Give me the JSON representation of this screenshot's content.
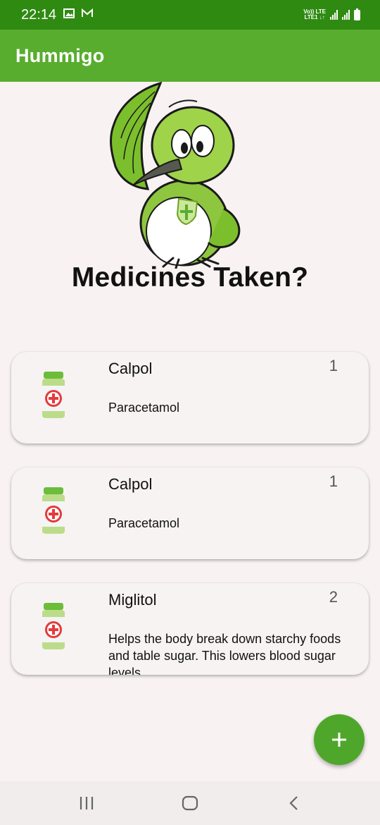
{
  "status_bar": {
    "time": "22:14",
    "notification_icons": [
      "image-icon",
      "gmail-icon"
    ],
    "network_label_top": "Vo)) LTE",
    "network_label_bottom": "LTE1 ↓↑",
    "signal_icons": [
      "signal-icon",
      "signal-icon"
    ],
    "battery_icon": "battery-icon"
  },
  "app_bar": {
    "title": "Hummigo"
  },
  "main": {
    "headline": "Medicines Taken?",
    "mascot_icon": "hummingbird-mascot-icon"
  },
  "medicines": [
    {
      "name": "Calpol",
      "count": "1",
      "description": "Paracetamol"
    },
    {
      "name": "Calpol",
      "count": "1",
      "description": "Paracetamol"
    },
    {
      "name": "Miglitol",
      "count": "2",
      "description": "Helps the body break down starchy foods and table sugar. This lowers blood sugar levels"
    }
  ],
  "fab": {
    "icon": "plus-icon"
  },
  "nav_bar": {
    "icons": [
      "recent-apps-icon",
      "home-icon",
      "back-icon"
    ]
  },
  "colors": {
    "status_bar": "#2f8a12",
    "app_bar": "#58ad2e",
    "fab": "#4ea72a",
    "background": "#f8f2f2",
    "nav_bar": "#f1eded"
  }
}
